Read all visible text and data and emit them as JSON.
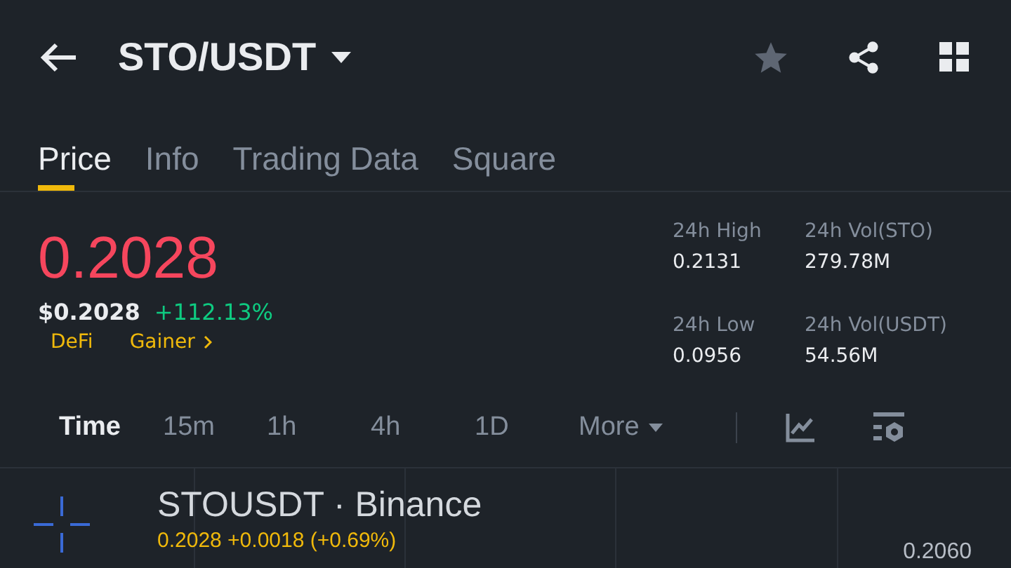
{
  "header": {
    "pair": "STO/USDT",
    "favorite": false
  },
  "tabs": [
    {
      "label": "Price",
      "selected": true
    },
    {
      "label": "Info",
      "selected": false
    },
    {
      "label": "Trading Data",
      "selected": false
    },
    {
      "label": "Square",
      "selected": false
    }
  ],
  "price": {
    "last": "0.2028",
    "usd": "$0.2028",
    "change": "+112.13%",
    "tags": [
      "DeFi",
      "Gainer"
    ]
  },
  "stats": [
    {
      "label": "24h High",
      "value": "0.2131"
    },
    {
      "label": "24h Vol(STO)",
      "value": "279.78M"
    },
    {
      "label": "24h Low",
      "value": "0.0956"
    },
    {
      "label": "24h Vol(USDT)",
      "value": "54.56M"
    }
  ],
  "intervals": [
    {
      "label": "Time",
      "selected": true
    },
    {
      "label": "15m",
      "selected": false
    },
    {
      "label": "1h",
      "selected": false
    },
    {
      "label": "4h",
      "selected": false
    },
    {
      "label": "1D",
      "selected": false
    },
    {
      "label": "More",
      "selected": false
    }
  ],
  "chart": {
    "title": "STOUSDT · Binance",
    "quote": "0.2028 +0.0018 (+0.69%)",
    "axis_label": "0.2060"
  }
}
